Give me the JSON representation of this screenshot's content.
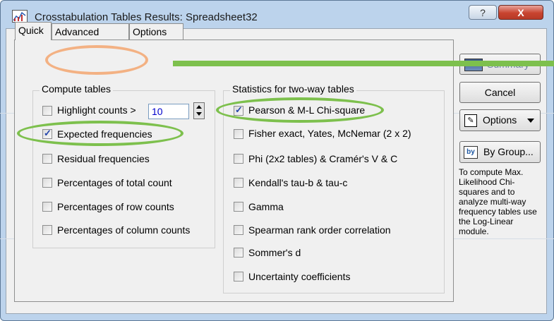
{
  "window": {
    "title": "Crosstabulation Tables Results: Spreadsheet32",
    "help_label": "?",
    "close_label": "X",
    "app_icon": "chart-app-icon"
  },
  "tabs": [
    {
      "label": "Quick",
      "active": true
    },
    {
      "label": "Advanced",
      "active": false
    },
    {
      "label": "Options",
      "active": false
    }
  ],
  "compute_tables": {
    "title": "Compute tables",
    "highlight": {
      "label": "Highlight counts >",
      "checked": false,
      "value": "10"
    },
    "items": [
      {
        "label": "Expected frequencies",
        "checked": true
      },
      {
        "label": "Residual frequencies",
        "checked": false
      },
      {
        "label": "Percentages of total count",
        "checked": false
      },
      {
        "label": "Percentages of row counts",
        "checked": false
      },
      {
        "label": "Percentages of column counts",
        "checked": false
      }
    ]
  },
  "statistics": {
    "title": "Statistics for two-way tables",
    "items": [
      {
        "label": "Pearson & M-L Chi-square",
        "checked": true
      },
      {
        "label": "Fisher exact, Yates, McNemar (2 x 2)",
        "checked": false
      },
      {
        "label": "Phi (2x2 tables) & Cramér's V &  C",
        "checked": false
      },
      {
        "label": "Kendall's tau-b & tau-c",
        "checked": false
      },
      {
        "label": "Gamma",
        "checked": false
      },
      {
        "label": "Spearman rank order correlation",
        "checked": false
      },
      {
        "label": "Sommer's d",
        "checked": false
      },
      {
        "label": "Uncertainty coefficients",
        "checked": false
      }
    ]
  },
  "buttons": {
    "summary": "Summary",
    "cancel": "Cancel",
    "options": "Options",
    "by_group": "By Group..."
  },
  "note": "To compute Max. Likelihood Chi-squares and to analyze multi-way frequency tables use the Log-Linear module.",
  "colors": {
    "highlight_green": "#7dc04d",
    "highlight_orange": "#f3b183",
    "title_bar": "#bcd3ec"
  }
}
